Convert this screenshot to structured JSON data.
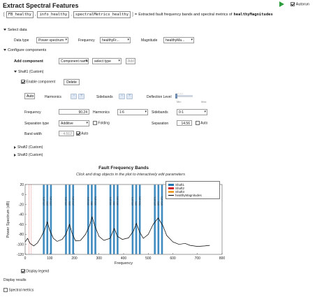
{
  "header": {
    "title": "Extract Spectral Features",
    "autorun_label": "Autorun",
    "outputs": [
      "FB_healthy",
      "info_healthy",
      "spectralMetrics_healthy"
    ],
    "equals": "=",
    "description_prefix": "Extracted fault frequency bands and spectral metrics of",
    "description_var": "healthyMagnitudes"
  },
  "select_data": {
    "section_label": "Select data",
    "data_type_label": "Data type",
    "data_type_value": "Power spectrum",
    "frequency_label": "Frequency",
    "frequency_value": "healthyFr...",
    "magnitude_label": "Magnitude",
    "magnitude_value": "healthyMa..."
  },
  "components": {
    "section_label": "Configure components",
    "add_label": "Add component",
    "name_placeholder": "Component name",
    "type_value": "select type",
    "add_button": "Add",
    "shaft1_label": "Shaft1 (Custom)",
    "enable_label": "Enable component",
    "delete_button": "Delete",
    "auto_button": "Auto",
    "harmonics_label": "Harmonics",
    "sidebands_label": "Sidebands",
    "deflection_label": "Deflection Level",
    "min_label": "Min",
    "max_label": "Max",
    "frequency_label": "Frequency",
    "frequency_value": "90.24",
    "harmonics_label2": "Harmonics",
    "harmonics_value": "1:6",
    "sidebands_label2": "Sidebands",
    "sidebands_value": "0:1",
    "separation_type_label": "Separation type",
    "separation_type_value": "Additive",
    "folding_label": "Folding",
    "separation_label": "Separation",
    "separation_value": "14.56",
    "auto_label": "Auto",
    "band_width_label": "Band width",
    "band_width_value": "4.512",
    "band_auto_label": "Auto",
    "shaft2_label": "Shaft2 (Custom)",
    "shaft3_label": "Shaft3 (Custom)"
  },
  "plot": {
    "title": "Fault Frequency Bands",
    "subtitle": "Click and drag objects in the plot to interactively edit parameters",
    "display_legend_label": "Display legend"
  },
  "display_results": {
    "section_label": "Display results",
    "spectral_metrics_label": "Spectral metrics"
  },
  "colors": {
    "shaft1": "#1f77b4",
    "shaft2": "#d62728",
    "shaft3": "#f0a030",
    "spectrum": "#000000",
    "autorun_green": "#2c9e3e"
  },
  "chart_data": {
    "type": "line",
    "title": "Fault Frequency Bands",
    "xlabel": "Frequency",
    "ylabel": "Power Spectrum (dB)",
    "xlim": [
      0,
      800
    ],
    "ylim": [
      -120,
      20
    ],
    "xticks": [
      0,
      100,
      200,
      300,
      400,
      500,
      600,
      700,
      800
    ],
    "yticks": [
      -120,
      -100,
      -80,
      -60,
      -40,
      -20,
      0,
      20
    ],
    "legend": [
      "Shaft1",
      "Shaft2",
      "Shaft3",
      "healthyMagnitudes"
    ],
    "legend_position": "top-right",
    "bands": {
      "shaft1_centers": [
        90.24,
        180.48,
        270.72,
        360.96,
        451.2,
        541.44
      ],
      "sideband_offsets": [
        -14.56,
        0,
        14.56
      ],
      "red_markers": [
        15,
        25
      ],
      "band_labels_top": [
        "6F0",
        "5F0",
        "4F0",
        "3F0",
        "2F0",
        "1F0"
      ],
      "sideband_label_prefixes": [
        "1F0+1F1",
        "2F0+1F1",
        "3F0+1F1",
        "4F0+1F1",
        "5F0+1F1",
        "6F0+1F1"
      ]
    },
    "spectrum": [
      {
        "x": 0,
        "y": -95
      },
      {
        "x": 10,
        "y": -88
      },
      {
        "x": 20,
        "y": -98
      },
      {
        "x": 35,
        "y": -103
      },
      {
        "x": 50,
        "y": -97
      },
      {
        "x": 65,
        "y": -85
      },
      {
        "x": 80,
        "y": -70
      },
      {
        "x": 90,
        "y": -55
      },
      {
        "x": 100,
        "y": -72
      },
      {
        "x": 115,
        "y": -88
      },
      {
        "x": 130,
        "y": -94
      },
      {
        "x": 150,
        "y": -90
      },
      {
        "x": 165,
        "y": -80
      },
      {
        "x": 180,
        "y": -60
      },
      {
        "x": 192,
        "y": -80
      },
      {
        "x": 205,
        "y": -93
      },
      {
        "x": 225,
        "y": -92
      },
      {
        "x": 245,
        "y": -80
      },
      {
        "x": 262,
        "y": -62
      },
      {
        "x": 272,
        "y": -45
      },
      {
        "x": 283,
        "y": -63
      },
      {
        "x": 300,
        "y": -84
      },
      {
        "x": 320,
        "y": -92
      },
      {
        "x": 345,
        "y": -88
      },
      {
        "x": 362,
        "y": -68
      },
      {
        "x": 375,
        "y": -84
      },
      {
        "x": 395,
        "y": -90
      },
      {
        "x": 420,
        "y": -87
      },
      {
        "x": 440,
        "y": -73
      },
      {
        "x": 452,
        "y": -58
      },
      {
        "x": 465,
        "y": -75
      },
      {
        "x": 480,
        "y": -88
      },
      {
        "x": 500,
        "y": -80
      },
      {
        "x": 520,
        "y": -60
      },
      {
        "x": 540,
        "y": -47
      },
      {
        "x": 560,
        "y": -63
      },
      {
        "x": 575,
        "y": -82
      },
      {
        "x": 600,
        "y": -95
      },
      {
        "x": 625,
        "y": -100
      },
      {
        "x": 650,
        "y": -98
      },
      {
        "x": 670,
        "y": -102
      },
      {
        "x": 700,
        "y": -104
      },
      {
        "x": 730,
        "y": -103
      },
      {
        "x": 750,
        "y": -102
      }
    ]
  }
}
